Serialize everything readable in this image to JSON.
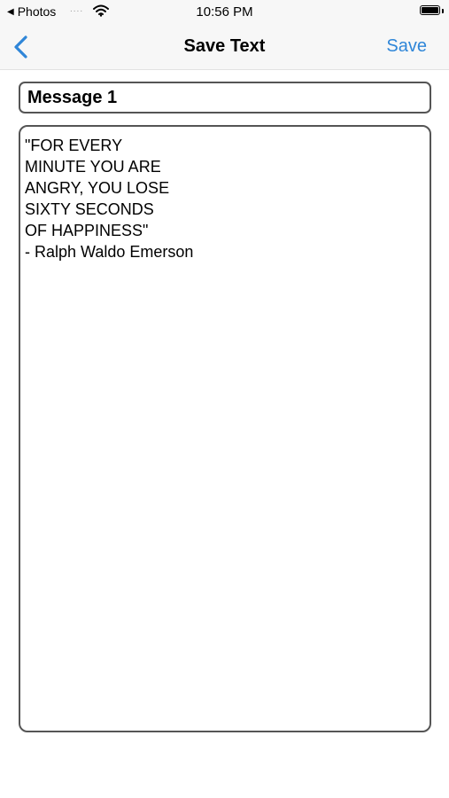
{
  "status_bar": {
    "back_app": "Photos",
    "signal": "....",
    "time": "10:56 PM"
  },
  "nav": {
    "title": "Save Text",
    "save_label": "Save"
  },
  "form": {
    "title_value": "Message 1",
    "body_value": "\"FOR EVERY\nMINUTE YOU ARE\nANGRY, YOU LOSE\nSIXTY SECONDS\nOF HAPPINESS\"\n- Ralph Waldo Emerson"
  },
  "colors": {
    "accent": "#2f86d8",
    "border": "#555555",
    "bar_background": "#f7f7f7"
  },
  "icons": {
    "back": "chevron-left-icon",
    "wifi": "wifi-icon",
    "battery": "battery-icon"
  }
}
